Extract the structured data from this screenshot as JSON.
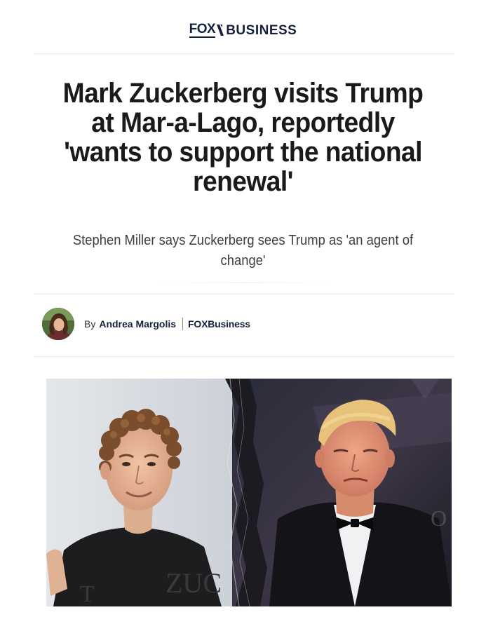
{
  "brand": {
    "logo_text_fox": "FOX",
    "logo_text_business": "BUSINESS",
    "colors": {
      "navy": "#14213d"
    }
  },
  "article": {
    "headline": "Mark Zuckerberg visits Trump at Mar-a-Lago, reportedly 'wants to support the national renewal'",
    "subheadline": "Stephen Miller says Zuckerberg sees Trump as 'an agent of change'",
    "byline": {
      "prefix": "By",
      "author": "Andrea Margolis",
      "outlet": "FOXBusiness"
    },
    "hero_image": {
      "left_shirt_text": "ZUC",
      "left_shirt_text_2": "T"
    }
  }
}
